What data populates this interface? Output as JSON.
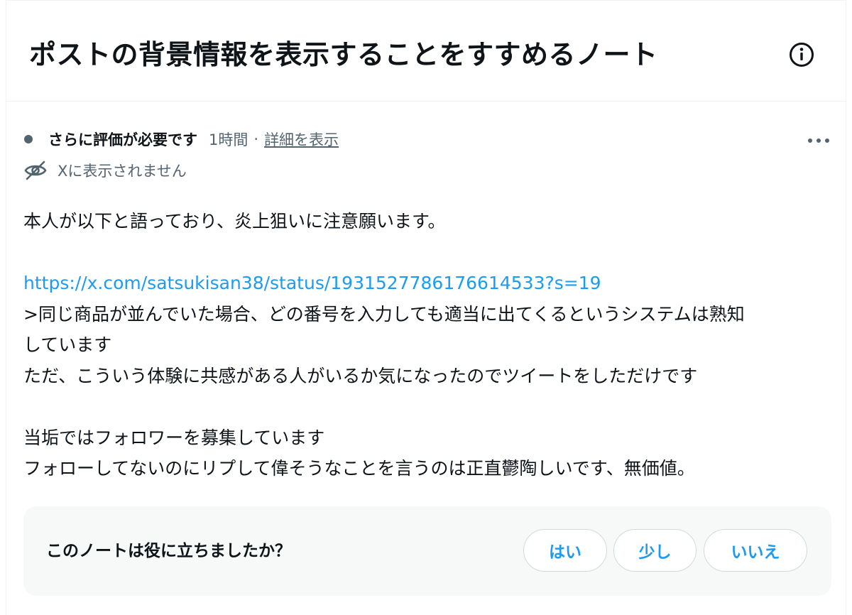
{
  "header": {
    "title": "ポストの背景情報を表示することをすすめるノート",
    "info_icon": "info-circle-icon"
  },
  "note": {
    "status_label": "さらに評価が必要です",
    "time": "1時間",
    "separator": "·",
    "details_link": "詳細を表示",
    "more_icon": "more-horizontal-icon",
    "visibility_icon": "eye-off-icon",
    "visibility_text": "Xに表示されません",
    "status_dot_color": "#536471",
    "link_color": "#1d9bf0",
    "body": {
      "line1": "本人が以下と語っており、炎上狙いに注意願います。",
      "blank1": "",
      "link": "https://x.com/satsukisan38/status/1931527786176614533?s=19",
      "line2": ">同じ商品が並んでいた場合、どの番号を入力しても適当に出てくるというシステムは熟知",
      "line3": "しています",
      "line4": "ただ、こういう体験に共感がある人がいるか気になったのでツイートをしただけです",
      "blank2": "",
      "line5": "当垢ではフォロワーを募集しています",
      "line6": "フォローしてないのにリプして偉そうなことを言うのは正直鬱陶しいです、無価値。"
    }
  },
  "rating": {
    "question": "このノートは役に立ちましたか？",
    "yes_label": "はい",
    "somewhat_label": "少し",
    "no_label": "いいえ"
  }
}
